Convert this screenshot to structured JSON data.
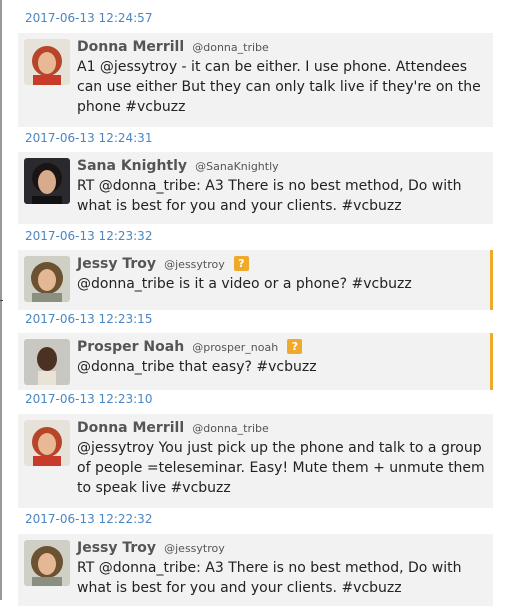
{
  "feed": {
    "top_timestamp": "2017-06-13 12:24:57",
    "tweets": [
      {
        "name": "Donna Merrill",
        "handle": "@donna_tribe",
        "text": "A1 @jessytroy - it can be either. I use phone. Attendees can use either But they can only talk live if they're on the phone #vcbuzz",
        "timestamp": "2017-06-13 12:24:31",
        "avatar": "avatar-donna-merrill"
      },
      {
        "name": "Sana Knightly",
        "handle": "@SanaKnightly",
        "text": "RT @donna_tribe: A3 There is no best method, Do with what is best for you and your clients. #vcbuzz",
        "timestamp": "2017-06-13 12:23:32",
        "avatar": "avatar-sana-knightly"
      },
      {
        "name": "Jessy Troy",
        "handle": "@jessytroy",
        "badge": "?",
        "text": "@donna_tribe is it a video or a phone? #vcbuzz",
        "timestamp": "2017-06-13 12:23:15",
        "avatar": "avatar-jessy-troy"
      },
      {
        "name": "Prosper Noah",
        "handle": "@prosper_noah",
        "badge": "?",
        "text": "@donna_tribe that easy? #vcbuzz",
        "timestamp": "2017-06-13 12:23:10",
        "avatar": "avatar-prosper-noah"
      },
      {
        "name": "Donna Merrill",
        "handle": "@donna_tribe",
        "text": "@jessytroy You just pick up the phone and talk to a group of people =teleseminar. Easy! Mute them + unmute them to speak live #vcbuzz",
        "timestamp": "2017-06-13 12:22:32",
        "avatar": "avatar-donna-merrill"
      },
      {
        "name": "Jessy Troy",
        "handle": "@jessytroy",
        "text": "RT @donna_tribe: A3 There is no best method, Do with what is best for you and your clients. #vcbuzz",
        "avatar": "avatar-jessy-troy"
      }
    ]
  },
  "colors": {
    "timestamp": "#4a86c4",
    "card_bg": "#f2f2f2",
    "question_badge": "#f0a92a"
  }
}
